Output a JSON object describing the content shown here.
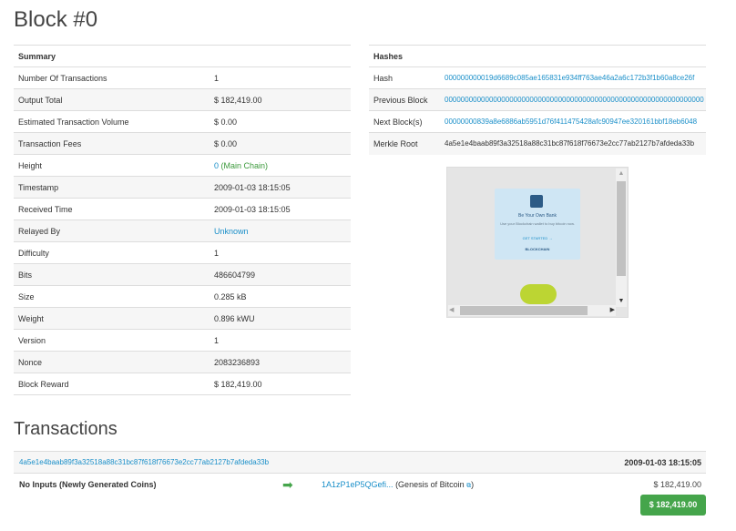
{
  "page": {
    "title": "Block #0"
  },
  "summary": {
    "header": "Summary",
    "rows": [
      {
        "label": "Number Of Transactions",
        "value": "1"
      },
      {
        "label": "Output Total",
        "value": "$ 182,419.00"
      },
      {
        "label": "Estimated Transaction Volume",
        "value": "$ 0.00"
      },
      {
        "label": "Transaction Fees",
        "value": "$ 0.00"
      },
      {
        "label": "Height",
        "value": "0",
        "suffix": "(Main Chain)"
      },
      {
        "label": "Timestamp",
        "value": "2009-01-03 18:15:05"
      },
      {
        "label": "Received Time",
        "value": "2009-01-03 18:15:05"
      },
      {
        "label": "Relayed By",
        "value": "Unknown"
      },
      {
        "label": "Difficulty",
        "value": "1"
      },
      {
        "label": "Bits",
        "value": "486604799"
      },
      {
        "label": "Size",
        "value": "0.285 kB"
      },
      {
        "label": "Weight",
        "value": "0.896 kWU"
      },
      {
        "label": "Version",
        "value": "1"
      },
      {
        "label": "Nonce",
        "value": "2083236893"
      },
      {
        "label": "Block Reward",
        "value": "$ 182,419.00"
      }
    ]
  },
  "hashes": {
    "header": "Hashes",
    "rows": [
      {
        "label": "Hash",
        "value": "000000000019d6689c085ae165831e934ff763ae46a2a6c172b3f1b60a8ce26f"
      },
      {
        "label": "Previous Block",
        "value": "0000000000000000000000000000000000000000000000000000000000000000"
      },
      {
        "label": "Next Block(s)",
        "value": "00000000839a8e6886ab5951d76f411475428afc90947ee320161bbf18eb6048"
      },
      {
        "label": "Merkle Root",
        "value": "4a5e1e4baab89f3a32518a88c31bc87f618f76673e2cc77ab2127b7afdeda33b"
      }
    ]
  },
  "ad": {
    "headline": "Be Your Own Bank",
    "body": "Use your Blockchain wallet to buy bitcoin now.",
    "cta": "GET STARTED →",
    "brand": "BLOCKCHAIN",
    "colors": {
      "card": "#cfe6f4",
      "pill": "#bcd533"
    }
  },
  "transactions": {
    "title": "Transactions",
    "items": [
      {
        "hash": "4a5e1e4baab89f3a32518a88c31bc87f618f76673e2cc77ab2127b7afdeda33b",
        "time": "2009-01-03 18:15:05",
        "inputs": "No Inputs (Newly Generated Coins)",
        "output_address": "1A1zP1eP5QGefi...",
        "output_note": "(Genesis of Bitcoin",
        "output_note_close": ")",
        "amount": "$ 182,419.00",
        "total": "$ 182,419.00"
      }
    ]
  },
  "colors": {
    "link": "#1a8fc9",
    "success": "#45a54b",
    "stripe": "#f6f6f6"
  }
}
